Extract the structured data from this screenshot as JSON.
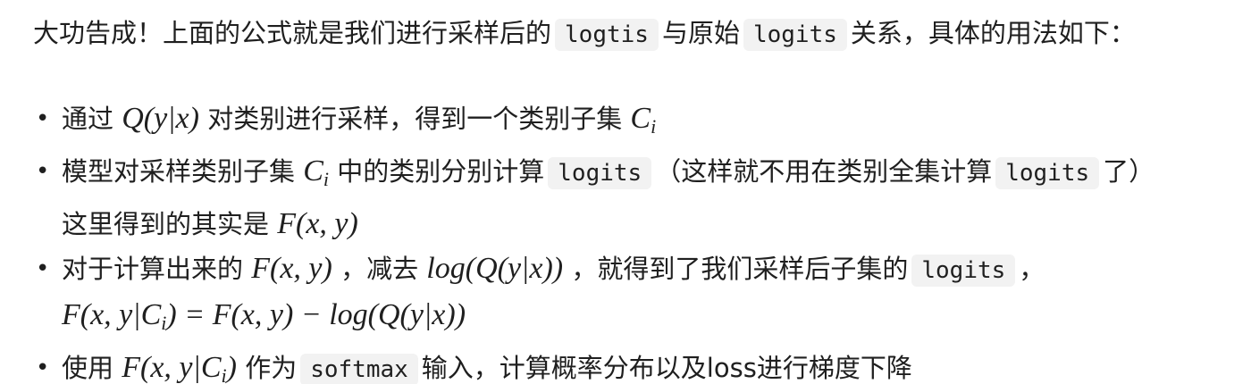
{
  "intro": {
    "part1": "大功告成！上面的公式就是我们进行采样后的",
    "code1": "logtis",
    "part2": "与原始",
    "code2": "logits",
    "part3": "关系，具体的用法如下："
  },
  "bullets": [
    {
      "t1": "通过",
      "m1": "Q(y|x)",
      "t2": "对类别进行采样，得到一个类别子集",
      "m2": "C",
      "m2sub": "i"
    },
    {
      "t1": "模型对采样类别子集",
      "m1": "C",
      "m1sub": "i",
      "t2": "中的类别分别计算",
      "code1": "logits",
      "t3": "（这样就不用在类别全集计算",
      "code2": "logits",
      "t4": "了）",
      "line2_text": "这里得到的其实是",
      "line2_math": "F(x, y)"
    },
    {
      "t1": "对于计算出来的",
      "m1": "F(x, y)",
      "t2": "，减去",
      "m2": "log(Q(y|x))",
      "t3": "，就得到了我们采样后子集的",
      "code1": "logits",
      "t4": "，",
      "line2_math_a": "F(x, y|C",
      "line2_sub": "i",
      "line2_math_b": ") = F(x, y) − log(Q(y|x))"
    },
    {
      "t1": "使用",
      "m1a": "F(x, y|C",
      "m1sub": "i",
      "m1b": ")",
      "t2": "作为",
      "code1": "softmax",
      "t3": "输入，计算概率分布以及loss进行梯度下降"
    }
  ],
  "bullet_glyph": "•"
}
